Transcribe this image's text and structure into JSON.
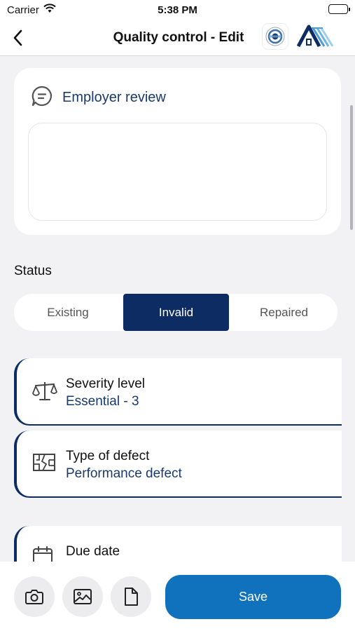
{
  "status_bar": {
    "carrier": "Carrier",
    "time": "5:38 PM"
  },
  "header": {
    "title": "Quality control - Edit"
  },
  "review": {
    "title": "Employer review",
    "text": ""
  },
  "status": {
    "label": "Status",
    "options": [
      "Existing",
      "Invalid",
      "Repaired"
    ],
    "selected": "Invalid"
  },
  "severity": {
    "label": "Severity level",
    "value": "Essential - 3"
  },
  "defect": {
    "label": "Type of defect",
    "value": "Performance defect"
  },
  "due_date": {
    "label": "Due date"
  },
  "footer": {
    "save_label": "Save"
  },
  "colors": {
    "primary": "#0d2c63",
    "accent": "#1072bd",
    "value_text": "#1a3a6b"
  }
}
